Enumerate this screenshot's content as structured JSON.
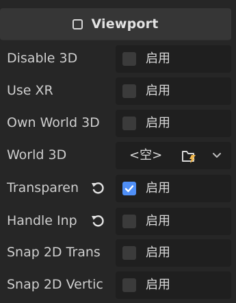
{
  "header": {
    "title": "Viewport",
    "icon": "checkbox-unchecked-icon"
  },
  "rows": [
    {
      "label": "Disable 3D",
      "checkbox_label": "启用",
      "checked": false,
      "revertable": false
    },
    {
      "label": "Use XR",
      "checkbox_label": "启用",
      "checked": false,
      "revertable": false
    },
    {
      "label": "Own World 3D",
      "checkbox_label": "启用",
      "checked": false,
      "revertable": false
    },
    {
      "label": "World 3D",
      "value": "<空>",
      "icons": [
        "folder-new-icon",
        "chevron-down-icon"
      ]
    },
    {
      "label": "Transparen",
      "checkbox_label": "启用",
      "checked": true,
      "revertable": true
    },
    {
      "label": "Handle Inp",
      "checkbox_label": "启用",
      "checked": false,
      "revertable": true
    },
    {
      "label": "Snap 2D Trans",
      "checkbox_label": "启用",
      "checked": false,
      "revertable": false
    },
    {
      "label": "Snap 2D Vertic",
      "checkbox_label": "启用",
      "checked": false,
      "revertable": false
    }
  ],
  "colors": {
    "accent": "#4f8ff7",
    "background": "#262626",
    "field": "#1f1f1f",
    "header": "#363636"
  }
}
